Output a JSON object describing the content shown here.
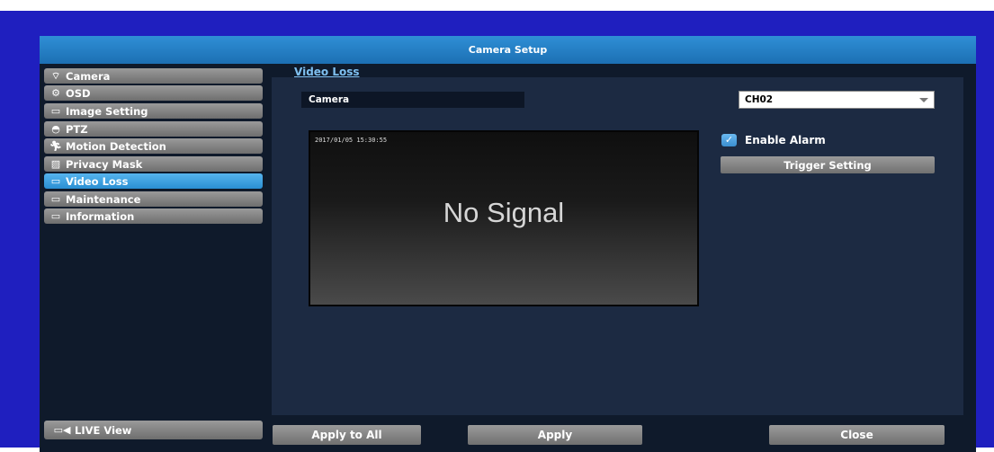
{
  "window": {
    "title": "Camera Setup"
  },
  "sidebar": {
    "items": [
      {
        "label": "Camera",
        "icon": "camera-icon",
        "active": false
      },
      {
        "label": "OSD",
        "icon": "osd-icon",
        "active": false
      },
      {
        "label": "Image Setting",
        "icon": "image-icon",
        "active": false
      },
      {
        "label": "PTZ",
        "icon": "ptz-icon",
        "active": false
      },
      {
        "label": "Motion Detection",
        "icon": "motion-icon",
        "active": false
      },
      {
        "label": "Privacy Mask",
        "icon": "mask-icon",
        "active": false
      },
      {
        "label": "Video Loss",
        "icon": "monitor-icon",
        "active": true
      },
      {
        "label": "Maintenance",
        "icon": "monitor-icon",
        "active": false
      },
      {
        "label": "Information",
        "icon": "monitor-icon",
        "active": false
      }
    ],
    "live_view_label": "LIVE View"
  },
  "main": {
    "section_title": "Video Loss",
    "camera_label": "Camera",
    "channel_value": "CH02",
    "video": {
      "timestamp": "2017/01/05 15:30:55",
      "status_text": "No Signal"
    },
    "enable_alarm_label": "Enable Alarm",
    "enable_alarm_checked": true,
    "trigger_setting_label": "Trigger Setting"
  },
  "footer": {
    "apply_all_label": "Apply to All",
    "apply_label": "Apply",
    "close_label": "Close"
  },
  "colors": {
    "outer_border": "#1f1fbf",
    "titlebar": "#2a86cf",
    "active_item": "#3a9fe0",
    "button_gray": "#8a8a8a",
    "panel": "#1c2a42"
  }
}
